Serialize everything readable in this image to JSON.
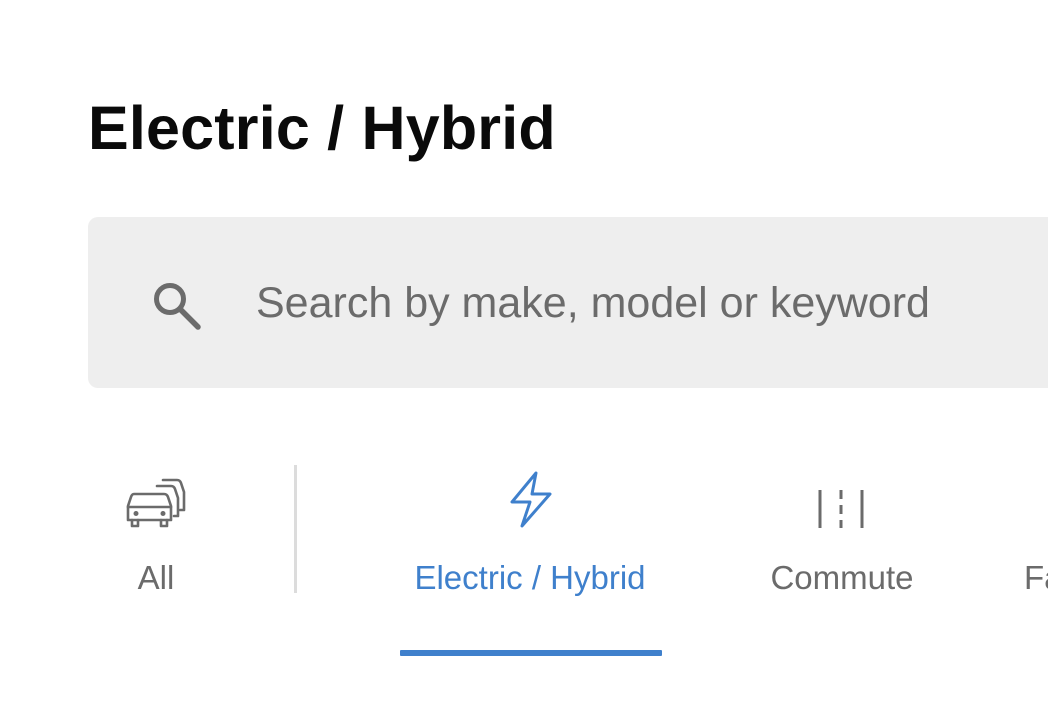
{
  "page": {
    "title": "Electric / Hybrid"
  },
  "search": {
    "icon": "search-icon",
    "placeholder": "Search by make, model or keyword",
    "value": ""
  },
  "categories": [
    {
      "label": "All",
      "icon": "cars-stack-icon",
      "active": false
    },
    {
      "label": "Electric / Hybrid",
      "icon": "lightning-bolt-icon",
      "active": true
    },
    {
      "label": "Commute",
      "icon": "road-lanes-icon",
      "active": false
    },
    {
      "label": "Fa",
      "icon": "",
      "active": false
    }
  ],
  "colors": {
    "accent": "#3f80cc",
    "title_text": "#0a0a0a",
    "muted_text": "#6b6b6b",
    "search_background": "#eeeeee",
    "divider": "#dcdcdc"
  }
}
